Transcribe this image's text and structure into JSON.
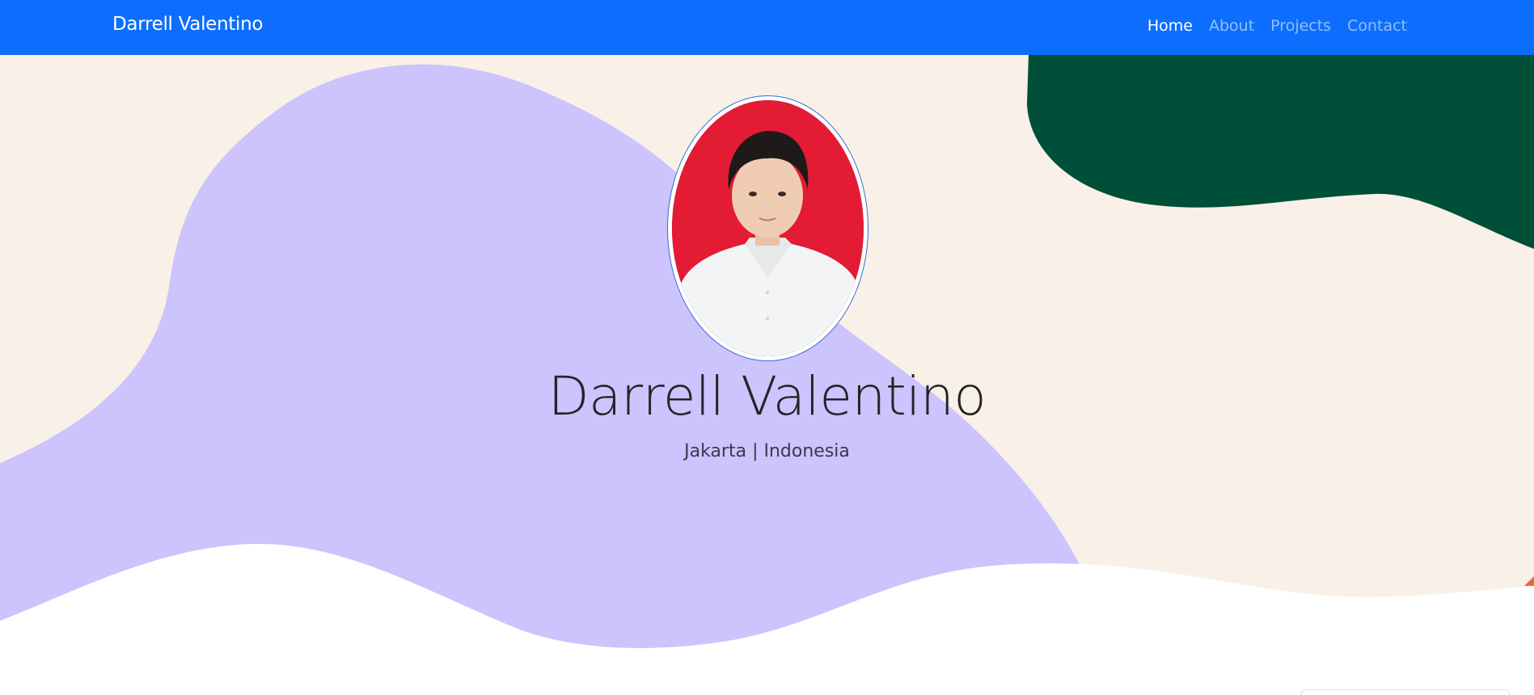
{
  "navbar": {
    "brand": "Darrell Valentino",
    "links": [
      {
        "label": "Home",
        "active": true
      },
      {
        "label": "About",
        "active": false
      },
      {
        "label": "Projects",
        "active": false
      },
      {
        "label": "Contact",
        "active": false
      }
    ]
  },
  "hero": {
    "name": "Darrell Valentino",
    "location": "Jakarta | Indonesia"
  },
  "colors": {
    "navbar": "#0d6efd",
    "cream": "#f9f0e7",
    "lavender": "#cdc3fd",
    "green": "#004f38",
    "portrait_bg": "#e31b34"
  }
}
